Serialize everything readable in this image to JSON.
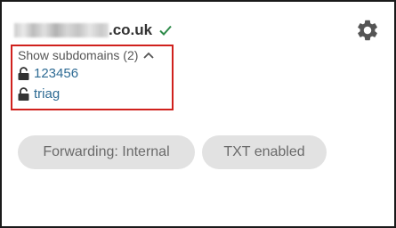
{
  "domain": {
    "suffix": ".co.uk",
    "verified_icon": "check-icon",
    "settings_icon": "gear-icon"
  },
  "subdomains": {
    "toggle_label": "Show subdomains (2)",
    "toggle_icon": "chevron-up-icon",
    "items": [
      {
        "name": "123456",
        "icon": "unlock-icon"
      },
      {
        "name": "triag",
        "icon": "unlock-icon"
      }
    ]
  },
  "badges": [
    {
      "label": "Forwarding: Internal"
    },
    {
      "label": "TXT enabled"
    }
  ],
  "colors": {
    "highlight": "#d0211d",
    "link": "#2e6b94",
    "verified": "#2e8b4a",
    "pill_bg": "#e2e2e2"
  }
}
